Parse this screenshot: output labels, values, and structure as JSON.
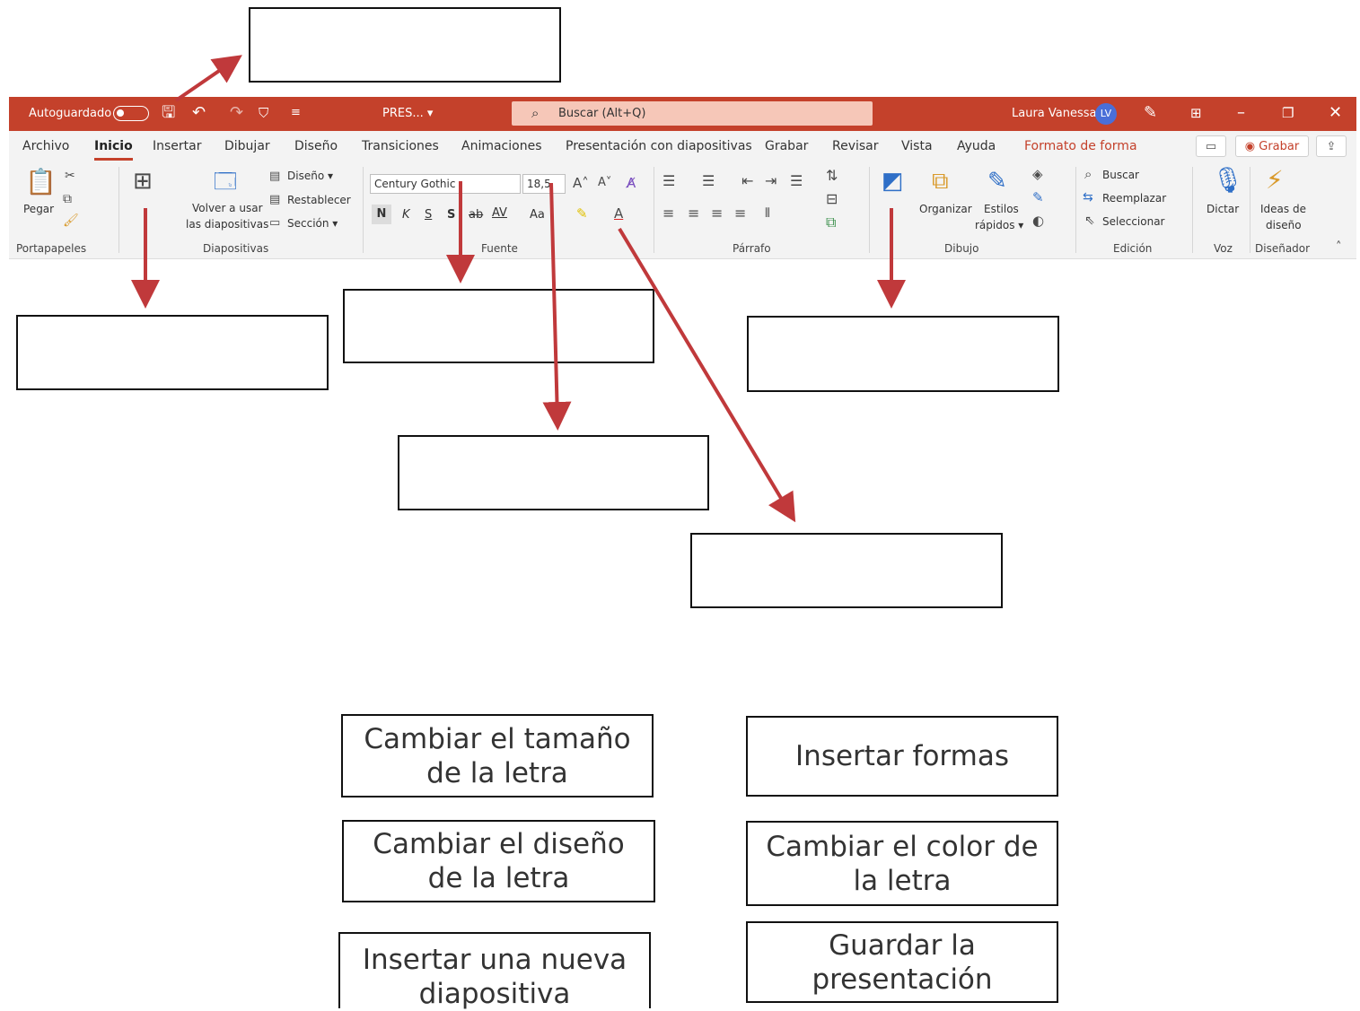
{
  "titlebar": {
    "autosave_label": "Autoguardado",
    "doc_name": "PRES... ▾",
    "search_placeholder": "Buscar (Alt+Q)",
    "user_name": "Laura Vanessa",
    "user_initials": "LV"
  },
  "tabs": [
    "Archivo",
    "Inicio",
    "Insertar",
    "Dibujar",
    "Diseño",
    "Transiciones",
    "Animaciones",
    "Presentación con diapositivas",
    "Grabar",
    "Revisar",
    "Vista",
    "Ayuda",
    "Formato de forma"
  ],
  "tab_buttons": {
    "record": "Grabar"
  },
  "ribbon": {
    "clipboard": {
      "paste": "Pegar",
      "label": "Portapapeles"
    },
    "slides": {
      "reuse_line1": "Volver a usar",
      "reuse_line2": "las diapositivas",
      "layout": "Diseño ▾",
      "reset": "Restablecer",
      "section": "Sección ▾",
      "label": "Diapositivas"
    },
    "font": {
      "font_name": "Century Gothic",
      "font_size": "18,5",
      "bold": "N",
      "italic": "K",
      "underline": "S",
      "shadow": "S",
      "strike": "ab",
      "spacing": "AV",
      "case": "Aa",
      "label": "Fuente"
    },
    "paragraph": {
      "label": "Párrafo"
    },
    "drawing": {
      "arrange": "Organizar",
      "quick_styles_line1": "Estilos",
      "quick_styles_line2": "rápidos ▾",
      "label": "Dibujo"
    },
    "editing": {
      "find": "Buscar",
      "replace": "Reemplazar",
      "select": "Seleccionar",
      "label": "Edición"
    },
    "voice": {
      "dictate": "Dictar",
      "label": "Voz"
    },
    "designer": {
      "ideas_line1": "Ideas de",
      "ideas_line2": "diseño",
      "label": "Diseñador"
    }
  },
  "options": [
    {
      "line1": "Cambiar el tamaño",
      "line2": "de la letra"
    },
    {
      "line1": "Insertar formas",
      "line2": ""
    },
    {
      "line1": "Cambiar el diseño",
      "line2": "de la letra"
    },
    {
      "line1": "Cambiar el color de",
      "line2": "la letra"
    },
    {
      "line1": "Insertar una nueva",
      "line2": "diapositiva"
    },
    {
      "line1": "Guardar la",
      "line2": "presentación"
    }
  ],
  "colors": {
    "accent": "#c4412b",
    "arrow": "#c0393b",
    "search_bg": "#f6c7b8"
  }
}
